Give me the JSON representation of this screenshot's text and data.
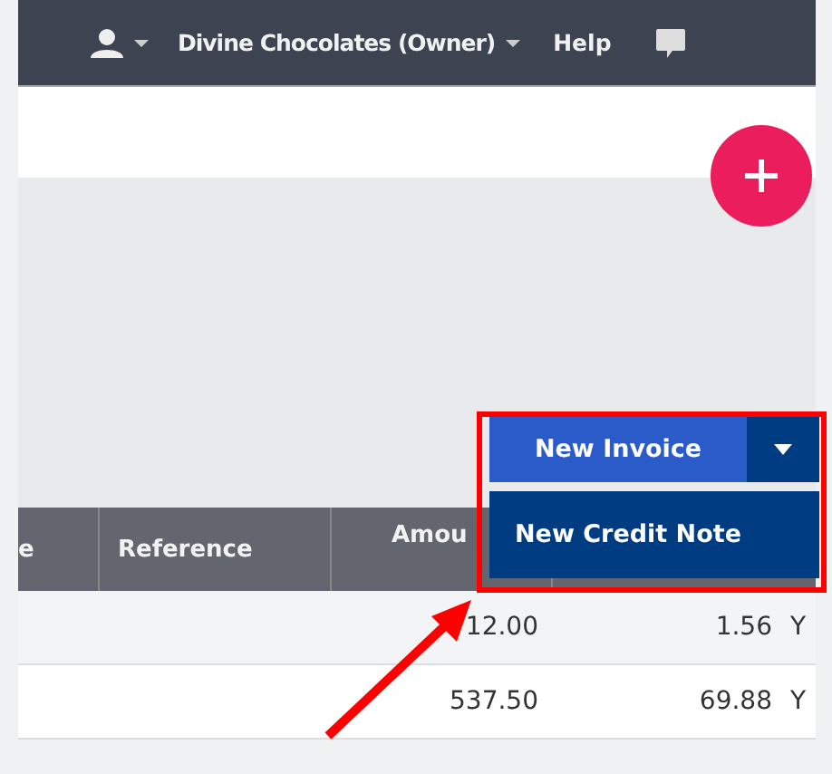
{
  "top_bar": {
    "account_menu": "Divine Chocolates (Owner)",
    "help": "Help"
  },
  "table": {
    "columns": [
      "e",
      "Reference",
      "Amou"
    ],
    "rows": [
      {
        "amount": "12.00",
        "column_4": "1.56",
        "column_5": "Y"
      },
      {
        "amount": "537.50",
        "column_4": "69.88",
        "column_5": "Y"
      }
    ]
  },
  "split_button": {
    "label": "New Invoice",
    "expanded": true,
    "menu": [
      {
        "label": "New Credit Note"
      }
    ]
  }
}
